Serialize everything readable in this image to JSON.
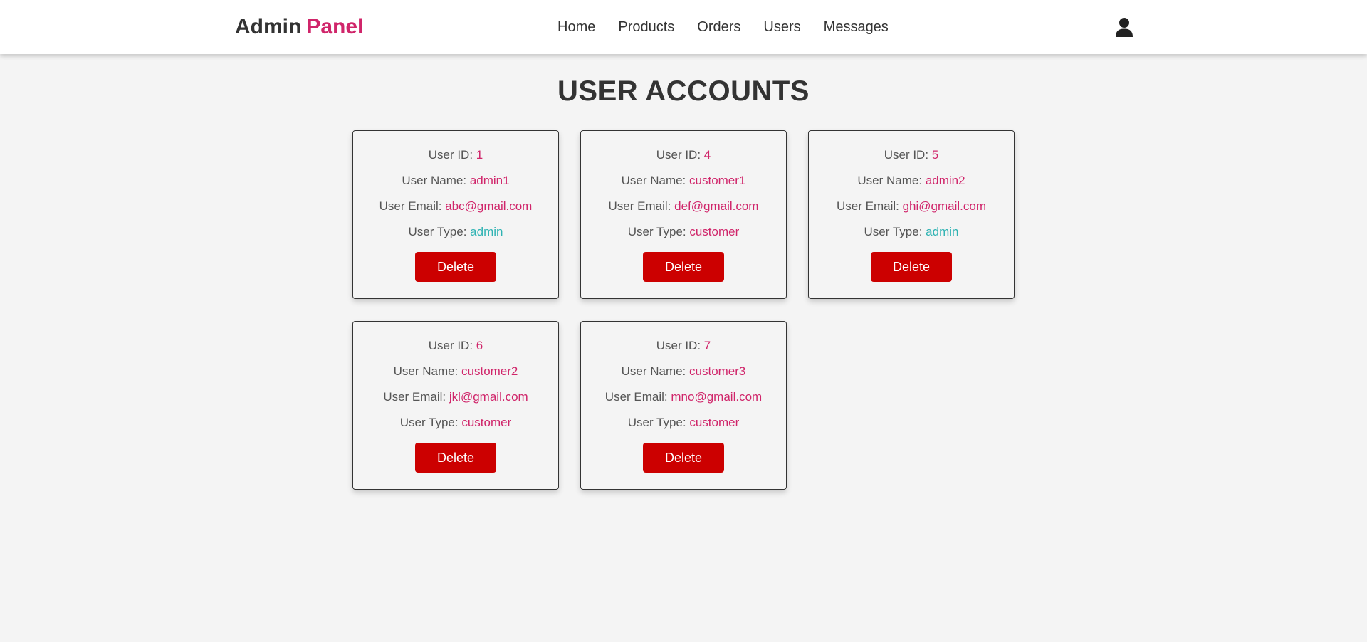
{
  "header": {
    "logo_main": "Admin",
    "logo_accent": "Panel",
    "nav": [
      "Home",
      "Products",
      "Orders",
      "Users",
      "Messages"
    ],
    "user_icon": "user-icon"
  },
  "page_title": "USER ACCOUNTS",
  "labels": {
    "id": "User ID:",
    "name": "User Name:",
    "email": "User Email:",
    "type": "User Type:",
    "delete": "Delete"
  },
  "colors": {
    "accent": "#d0256a",
    "admin_type": "#2fb3b3",
    "delete_button": "#cc0000"
  },
  "users": [
    {
      "id": "1",
      "name": "admin1",
      "email": "abc@gmail.com",
      "type": "admin"
    },
    {
      "id": "4",
      "name": "customer1",
      "email": "def@gmail.com",
      "type": "customer"
    },
    {
      "id": "5",
      "name": "admin2",
      "email": "ghi@gmail.com",
      "type": "admin"
    },
    {
      "id": "6",
      "name": "customer2",
      "email": "jkl@gmail.com",
      "type": "customer"
    },
    {
      "id": "7",
      "name": "customer3",
      "email": "mno@gmail.com",
      "type": "customer"
    }
  ]
}
